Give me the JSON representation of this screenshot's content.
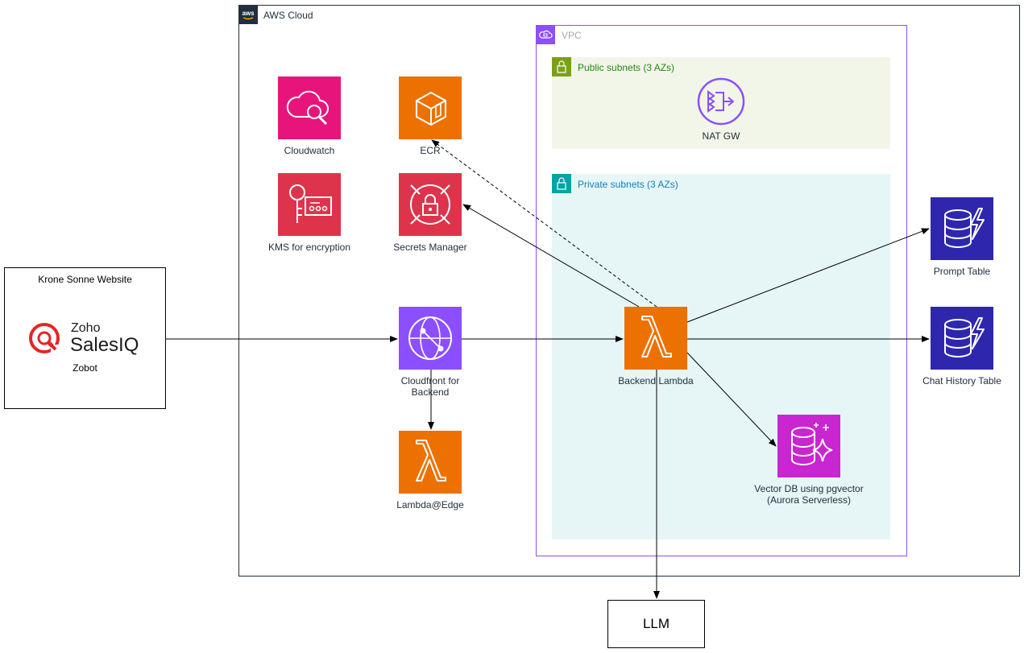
{
  "external": {
    "website_title": "Krone Sonne Website",
    "zoho_word": "Zoho",
    "salesiq_word": "SalesIQ",
    "zobot_label": "Zobot"
  },
  "aws": {
    "title": "AWS Cloud"
  },
  "vpc": {
    "title": "VPC",
    "public_subnets": "Public subnets (3 AZs)",
    "private_subnets": "Private subnets (3 AZs)"
  },
  "services": {
    "cloudwatch": "Cloudwatch",
    "ecr": "ECR",
    "kms": "KMS for encryption",
    "secrets": "Secrets Manager",
    "cloudfront_line1": "Cloudfront for",
    "cloudfront_line2": "Backend",
    "lambda_edge": "Lambda@Edge",
    "nat_gw": "NAT GW",
    "backend_lambda": "Backend Lambda",
    "vector_db_line1": "Vector DB using pgvector",
    "vector_db_line2": "(Aurora Serverless)",
    "prompt_table": "Prompt Table",
    "chat_history_table": "Chat History Table",
    "llm": "LLM"
  },
  "colors": {
    "cloudwatch": "#e7157b",
    "compute": "#ed7100",
    "security": "#dd344c",
    "networking": "#8c4fff",
    "database": "#c925d1",
    "dynamodb": "#2e27ad",
    "public_subnet_fill": "#f2f6e8",
    "public_subnet_text": "#248814",
    "private_subnet_fill": "#e6f6f7",
    "private_subnet_text": "#147eba",
    "zoho_red": "#e42527"
  }
}
